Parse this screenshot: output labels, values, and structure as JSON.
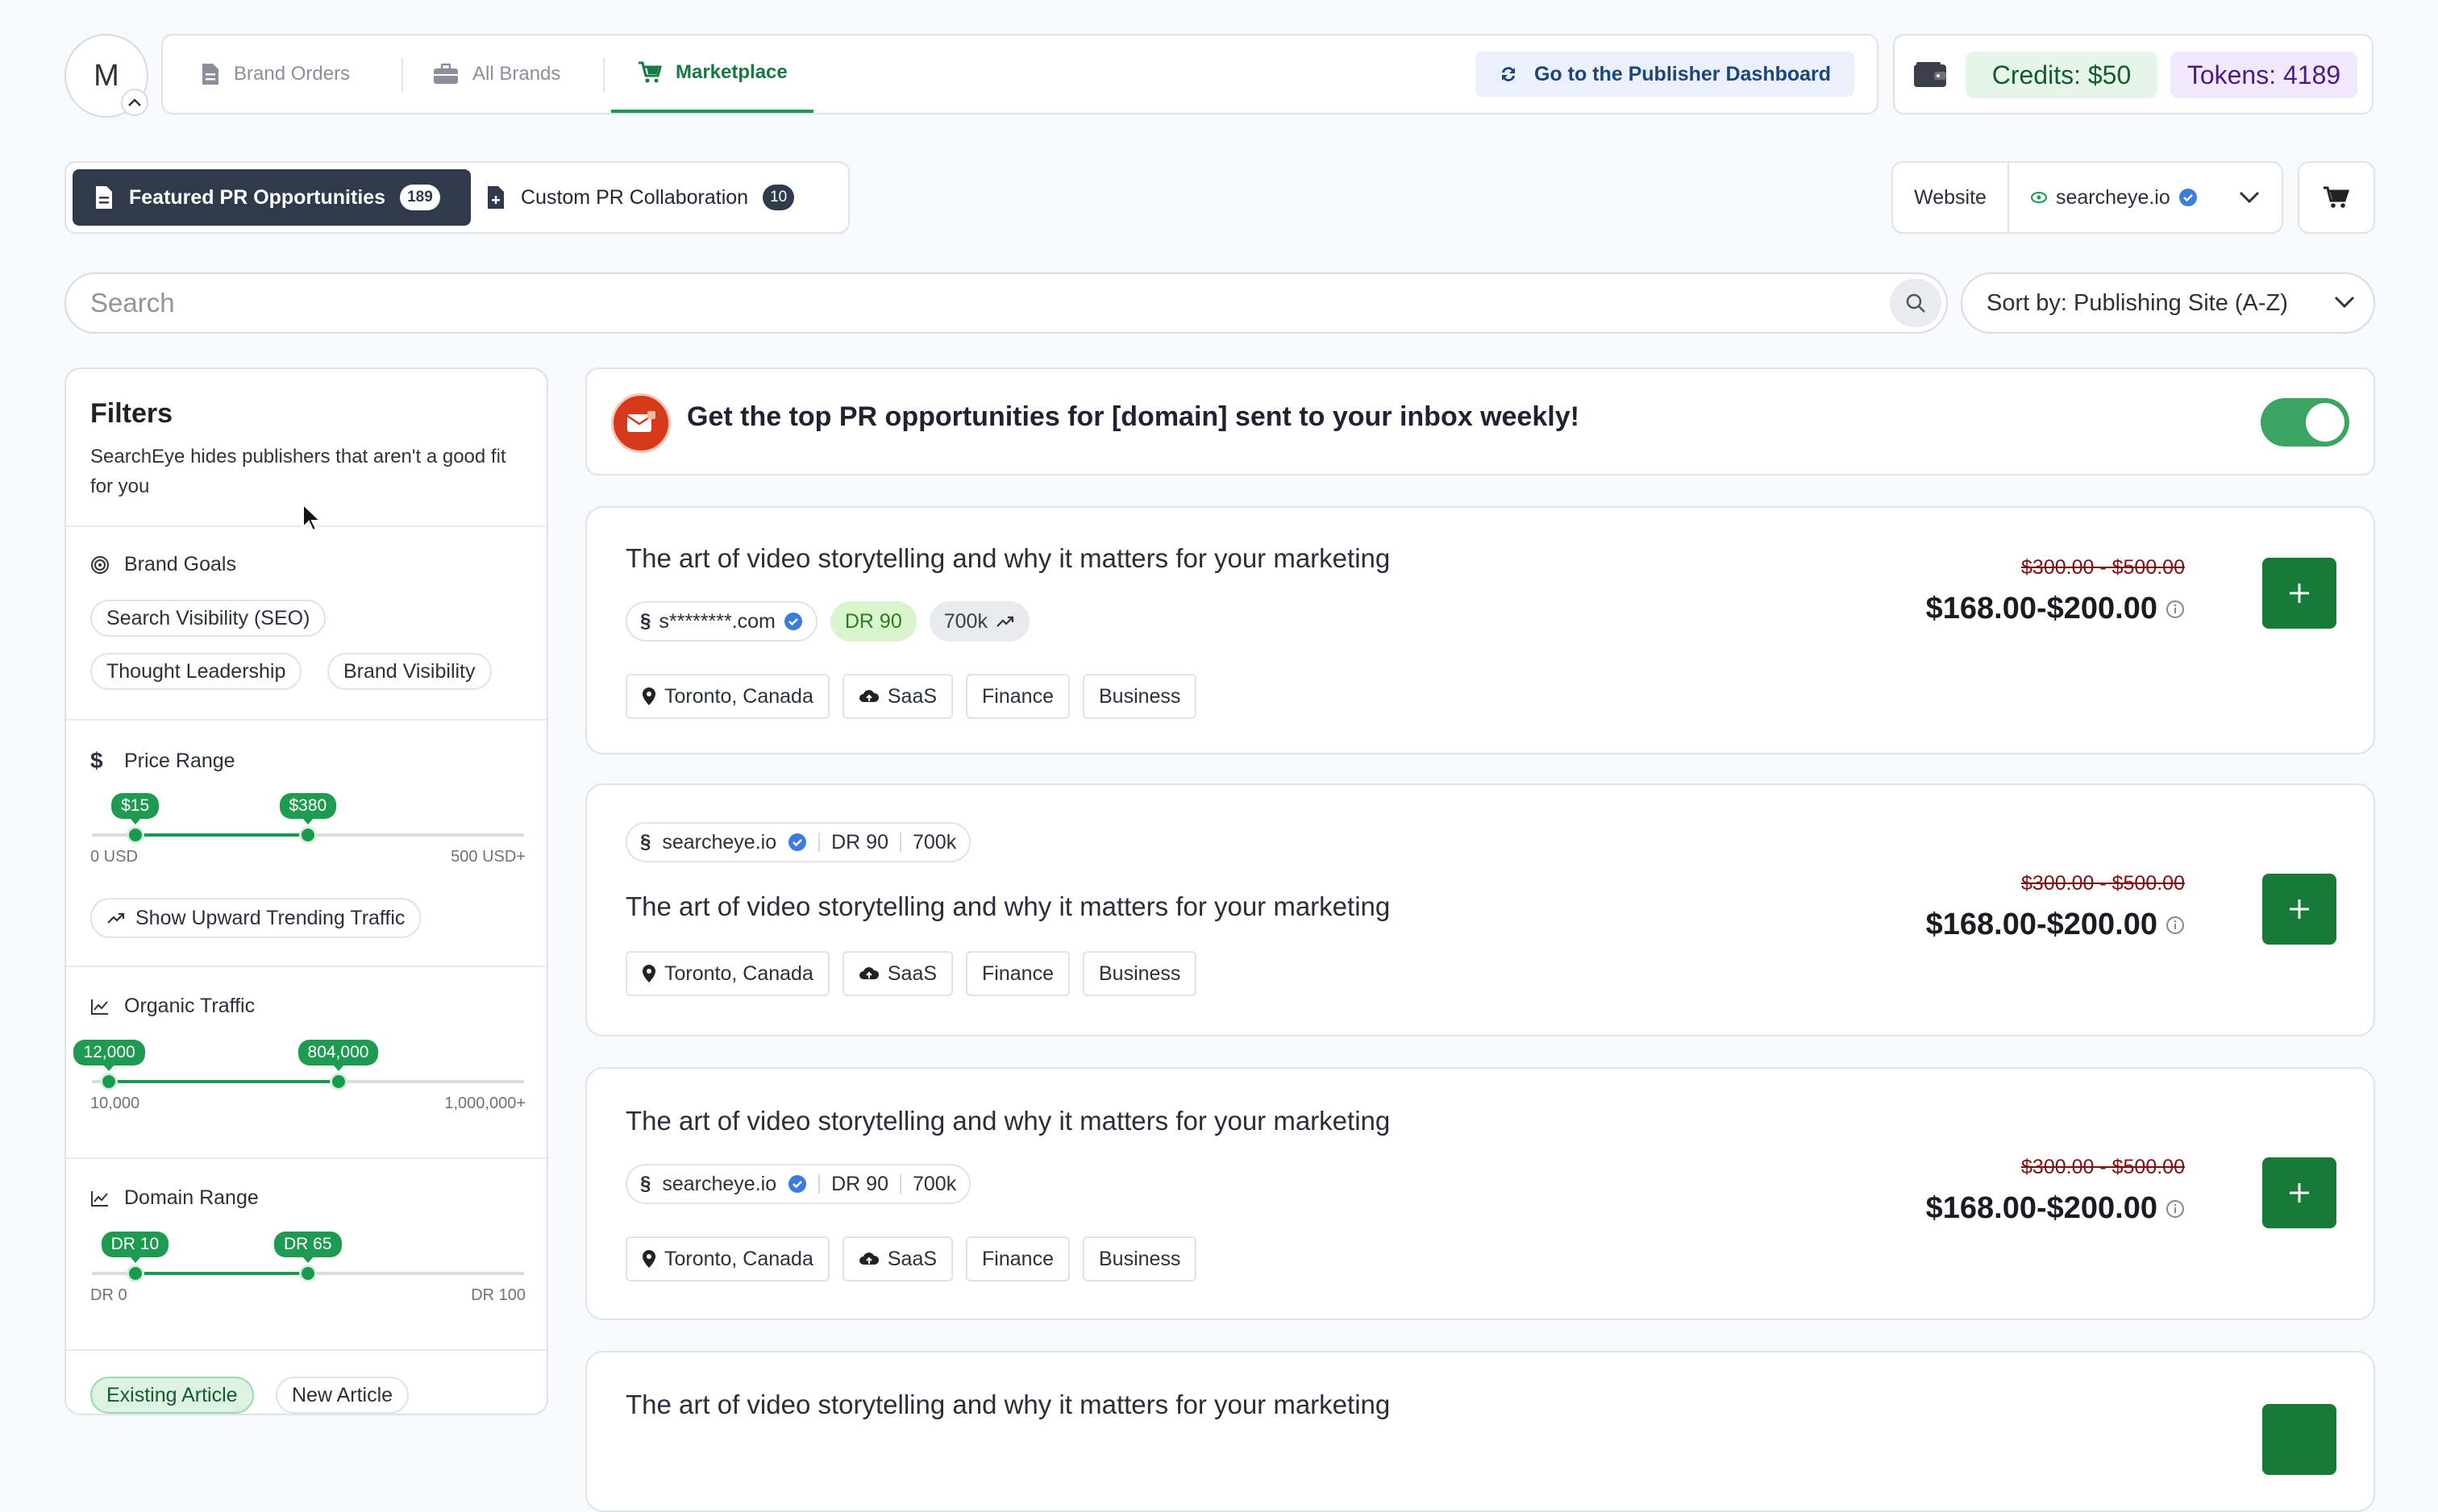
{
  "user": {
    "initial": "M"
  },
  "nav": {
    "tabs": [
      {
        "label": "Brand Orders"
      },
      {
        "label": "All Brands"
      },
      {
        "label": "Marketplace"
      }
    ],
    "publisher_button": "Go to the Publisher Dashboard"
  },
  "wallet": {
    "credits": "Credits: $50",
    "tokens": "Tokens: 4189"
  },
  "opportunities": {
    "featured_label": "Featured PR Opportunities",
    "featured_count": "189",
    "custom_label": "Custom PR Collaboration",
    "custom_count": "10"
  },
  "website": {
    "label": "Website",
    "value": "searcheye.io"
  },
  "search": {
    "placeholder": "Search"
  },
  "sort": {
    "label": "Sort by: Publishing Site (A-Z)"
  },
  "filters": {
    "title": "Filters",
    "description": "SearchEye hides publishers that aren't a good fit for you",
    "brand_goals": {
      "title": "Brand Goals",
      "chips": [
        "Search Visibility (SEO)",
        "Thought Leadership",
        "Brand Visibility"
      ]
    },
    "price_range": {
      "title": "Price Range",
      "min_tag": "$15",
      "max_tag": "$380",
      "min_label": "0 USD",
      "max_label": "500 USD+",
      "low_fraction": 0.1,
      "high_fraction": 0.5,
      "trending_chip": "Show Upward Trending Traffic"
    },
    "organic_traffic": {
      "title": "Organic Traffic",
      "min_tag": "12,000",
      "max_tag": "804,000",
      "min_label": "10,000",
      "max_label": "1,000,000+",
      "low_fraction": 0.04,
      "high_fraction": 0.57
    },
    "domain_range": {
      "title": "Domain Range",
      "min_tag": "DR 10",
      "max_tag": "DR 65",
      "min_label": "DR 0",
      "max_label": "DR 100",
      "low_fraction": 0.1,
      "high_fraction": 0.5
    },
    "article_types": [
      "Existing Article",
      "New Article"
    ]
  },
  "banner": {
    "text": "Get the top PR opportunities for [domain] sent to your inbox weekly!"
  },
  "cards": [
    {
      "title": "The art of video storytelling and why it matters for your marketing",
      "site": "s********.com",
      "dr": "DR 90",
      "traffic": "700k",
      "location": "Toronto, Canada",
      "categories": [
        "SaaS",
        "Finance",
        "Business"
      ],
      "old_price": "$300.00 - $500.00",
      "price": "$168.00-$200.00"
    },
    {
      "title": "The art of video storytelling and why it matters for your marketing",
      "site": "searcheye.io",
      "dr": "DR 90",
      "traffic": "700k",
      "location": "Toronto, Canada",
      "categories": [
        "SaaS",
        "Finance",
        "Business"
      ],
      "old_price": "$300.00 - $500.00",
      "price": "$168.00-$200.00"
    },
    {
      "title": "The art of video storytelling and why it matters for your marketing",
      "site": "searcheye.io",
      "dr": "DR 90",
      "traffic": "700k",
      "location": "Toronto, Canada",
      "categories": [
        "SaaS",
        "Finance",
        "Business"
      ],
      "old_price": "$300.00 - $500.00",
      "price": "$168.00-$200.00"
    },
    {
      "title": "The art of video storytelling and why it matters for your marketing"
    }
  ]
}
